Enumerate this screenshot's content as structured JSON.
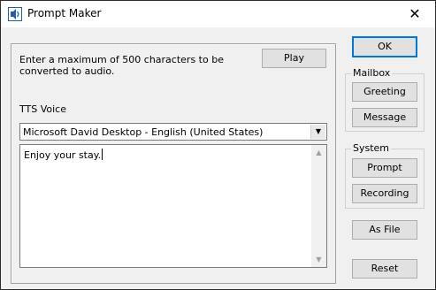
{
  "window": {
    "title": "Prompt Maker",
    "close_glyph": "✕",
    "icon": "speaker-d-icon"
  },
  "main": {
    "instructions": "Enter a maximum of 500 characters to be converted to audio.",
    "play_label": "Play",
    "tts_voice_label": "TTS Voice",
    "voice_selected": "Microsoft David Desktop - English (United States)",
    "text_value": "Enjoy your stay."
  },
  "side": {
    "ok_label": "OK",
    "mailbox": {
      "label": "Mailbox",
      "greeting_label": "Greeting",
      "message_label": "Message"
    },
    "system": {
      "label": "System",
      "prompt_label": "Prompt",
      "recording_label": "Recording"
    },
    "as_file_label": "As File",
    "reset_label": "Reset"
  },
  "colors": {
    "focus_border": "#0078d7",
    "button_face": "#e1e1e1",
    "window_bg": "#f0f0f0"
  }
}
